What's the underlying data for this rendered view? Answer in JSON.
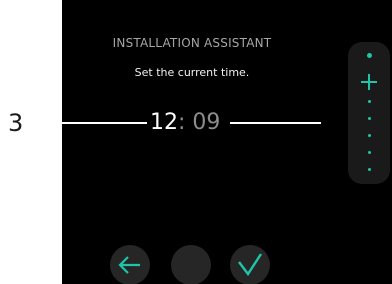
{
  "step": {
    "number": "3"
  },
  "assistant": {
    "title": "INSTALLATION ASSISTANT",
    "instruction": "Set the current time."
  },
  "time": {
    "hours": "12",
    "separator": ":",
    "minutes": " 09"
  },
  "icons": {
    "increment": "plus-icon",
    "back": "arrow-left-icon",
    "confirm": "checkmark-icon"
  },
  "colors": {
    "accent": "#1fc5a8",
    "screen_background": "#000000",
    "button_background": "#262626",
    "panel_background": "#1a1a1a"
  }
}
